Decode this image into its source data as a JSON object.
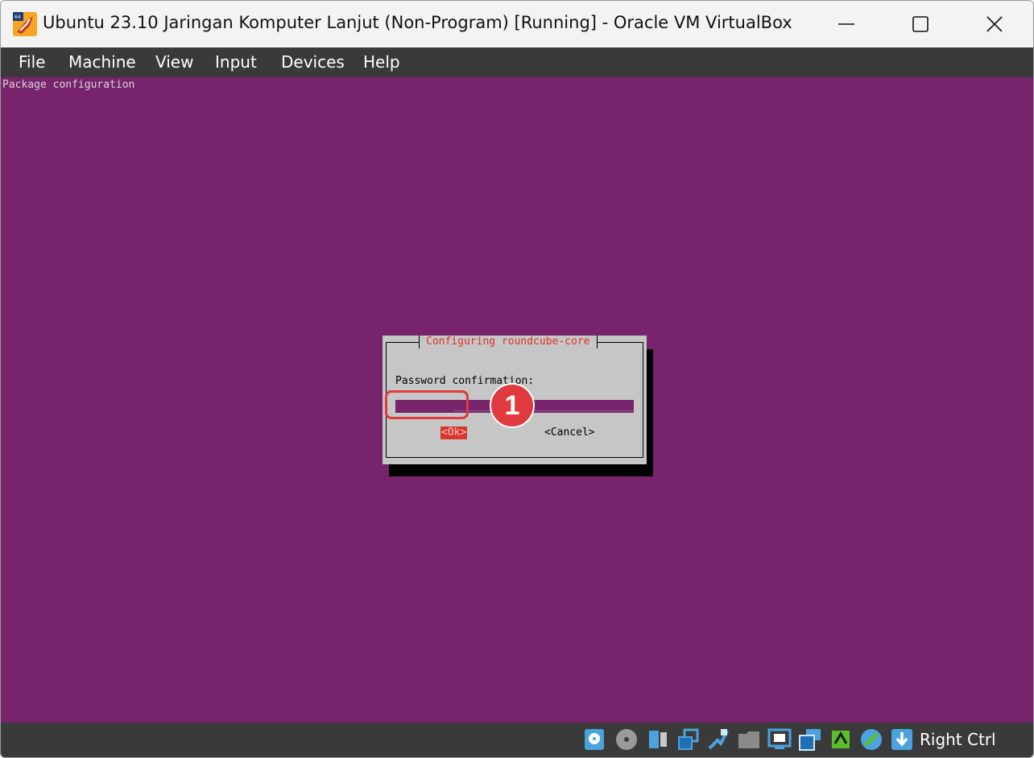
{
  "window": {
    "title": "Ubuntu 23.10 Jaringan Komputer Lanjut (Non-Program) [Running] - Oracle VM VirtualBox",
    "controls": {
      "minimize": "minimize-icon",
      "maximize": "maximize-icon",
      "close": "close-icon"
    }
  },
  "menu": {
    "items": [
      "File",
      "Machine",
      "View",
      "Input",
      "Devices",
      "Help"
    ]
  },
  "vm_screen": {
    "header": "Package configuration",
    "background": "#77246c",
    "dialog": {
      "title": "Configuring roundcube-core",
      "prompt": "Password confirmation:",
      "password_value": "*********",
      "field_fill": "_____________________________",
      "ok_label": "<Ok>",
      "cancel_label": "<Cancel>"
    }
  },
  "annotation": {
    "step_number": "1",
    "color": "#e0393e"
  },
  "statusbar": {
    "icons": [
      "hard-disk-icon",
      "optical-drive-icon",
      "audio-icon",
      "network-icon",
      "usb-icon",
      "shared-folders-icon",
      "display-icon",
      "recording-icon",
      "cpu-icon",
      "mouse-integration-icon",
      "keyboard-capture-icon"
    ],
    "host_key": "Right Ctrl"
  }
}
